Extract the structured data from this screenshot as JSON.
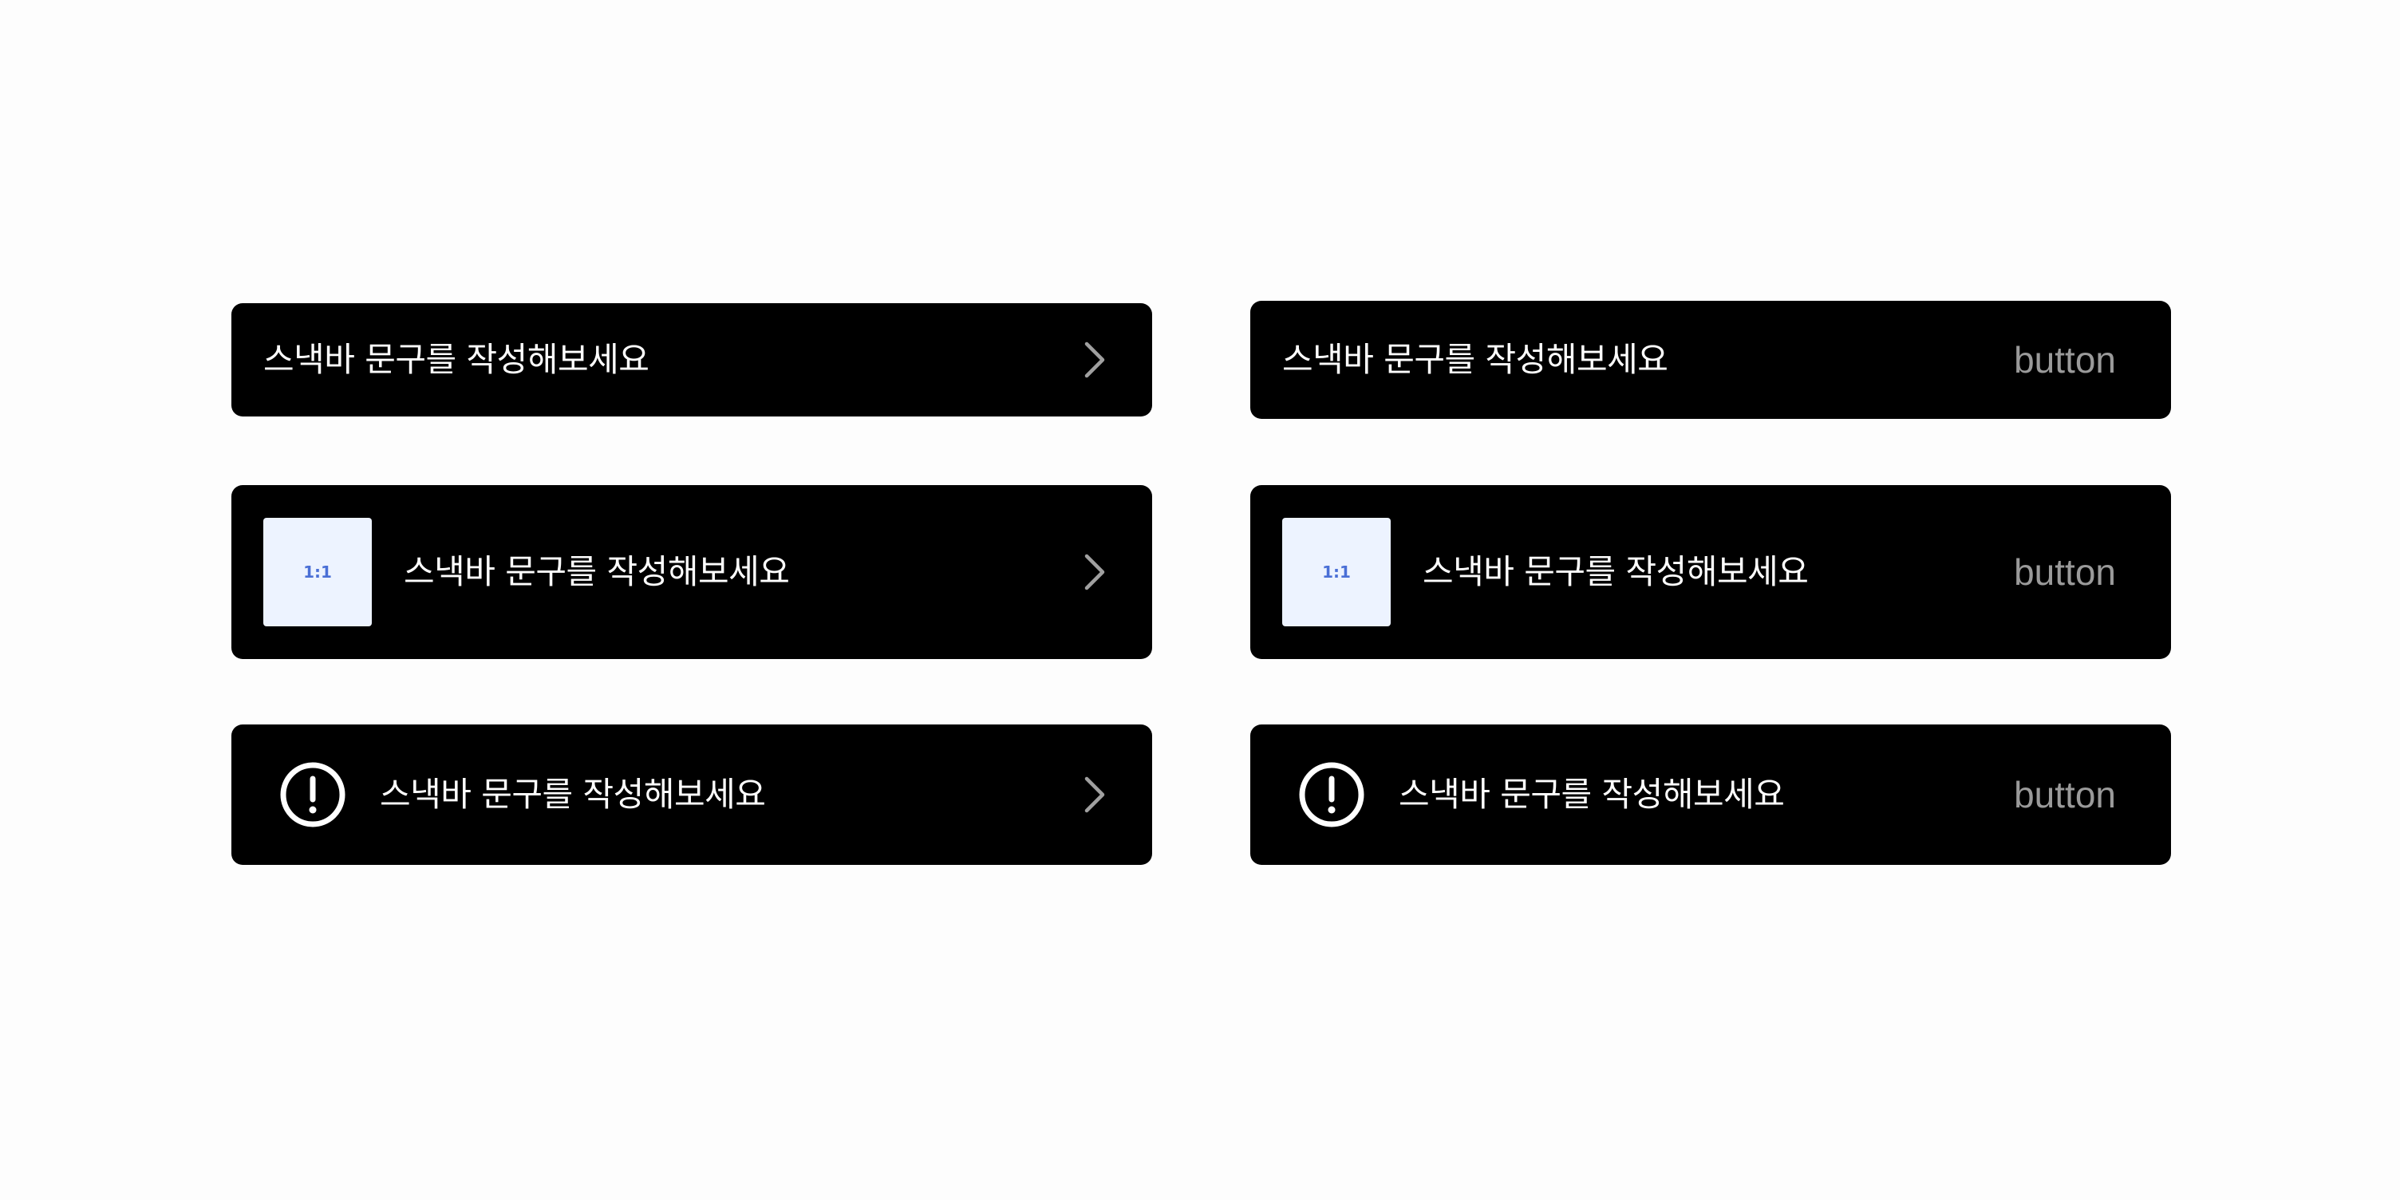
{
  "snackbars": [
    {
      "variant": "text-chevron",
      "message": "스낵바 문구를 작성해보세요",
      "chevron_icon": "chevron-right-icon"
    },
    {
      "variant": "text-button",
      "message": "스낵바 문구를 작성해보세요",
      "button_label": "button"
    },
    {
      "variant": "thumbnail-chevron",
      "thumbnail_label": "1:1",
      "message": "스낵바 문구를 작성해보세요",
      "chevron_icon": "chevron-right-icon"
    },
    {
      "variant": "thumbnail-button",
      "thumbnail_label": "1:1",
      "message": "스낵바 문구를 작성해보세요",
      "button_label": "button"
    },
    {
      "variant": "alert-chevron",
      "leading_icon": "alert-circle-icon",
      "message": "스낵바 문구를 작성해보세요",
      "chevron_icon": "chevron-right-icon"
    },
    {
      "variant": "alert-button",
      "leading_icon": "alert-circle-icon",
      "message": "스낵바 문구를 작성해보세요",
      "button_label": "button"
    }
  ],
  "colors": {
    "page_background": "#fdfdfd",
    "snackbar_background": "#000000",
    "message_text": "#ffffff",
    "button_text": "#9a9a9a",
    "chevron": "#a0a0a0",
    "thumbnail_background": "#edf3ff",
    "thumbnail_text": "#4a6fd6"
  }
}
